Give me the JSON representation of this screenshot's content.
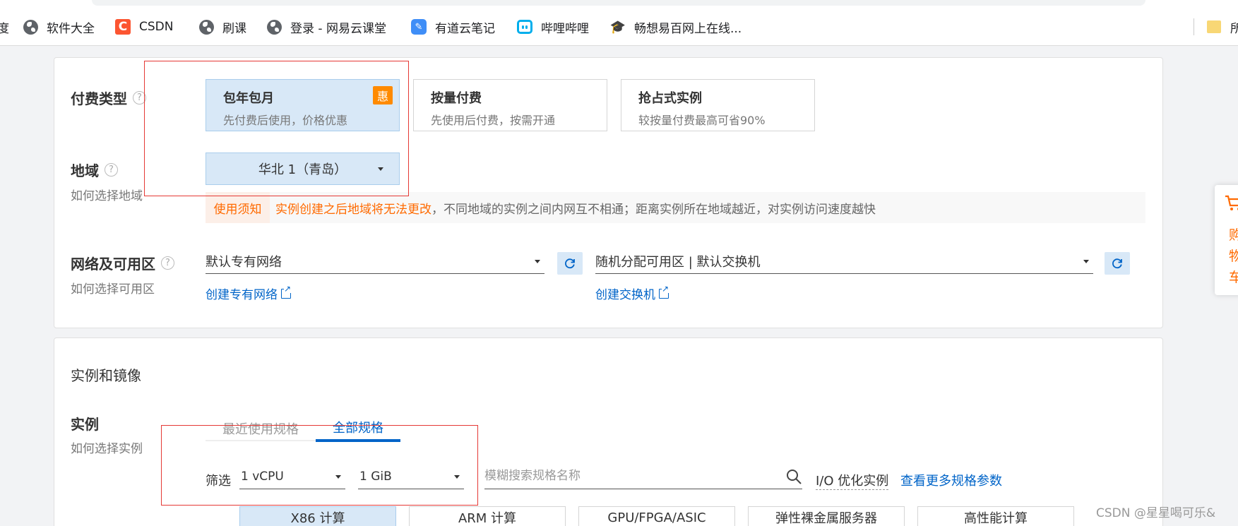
{
  "bookmarks": {
    "items": [
      {
        "label": "度",
        "icon": "none"
      },
      {
        "label": "软件大全",
        "icon": "globe-icon"
      },
      {
        "label": "CSDN",
        "icon": "csdn-icon"
      },
      {
        "label": "刷课",
        "icon": "globe-icon"
      },
      {
        "label": "登录 - 网易云课堂",
        "icon": "globe-icon"
      },
      {
        "label": "有道云笔记",
        "icon": "youdao-icon"
      },
      {
        "label": "哔哩哔哩",
        "icon": "bilibili-icon"
      },
      {
        "label": "畅想易百网上在线...",
        "icon": "graduation-cap-icon"
      },
      {
        "label": "所",
        "icon": "folder-icon"
      }
    ],
    "csdn_glyph": "C"
  },
  "payment": {
    "title": "付费类型",
    "help": "?",
    "options": [
      {
        "title": "包年包月",
        "desc": "先付费后使用，价格优惠",
        "badge": "惠",
        "selected": true
      },
      {
        "title": "按量付费",
        "desc": "先使用后付费，按需开通",
        "selected": false
      },
      {
        "title": "抢占式实例",
        "desc": "较按量付费最高可省90%",
        "selected": false
      }
    ]
  },
  "region": {
    "title": "地域",
    "help": "?",
    "how_link": "如何选择地域",
    "selected": "华北 1（青岛）",
    "notice_tag": "使用须知",
    "notice_warning": "实例创建之后地域将无法更改",
    "notice_rest": "，不同地域的实例之间内网互不相通；距离实例所在地域越近，对实例访问速度越快"
  },
  "network": {
    "title": "网络及可用区",
    "help": "?",
    "how_link": "如何选择可用区",
    "vpc_value": "默认专有网络",
    "zone_value": "随机分配可用区 | 默认交换机",
    "create_vpc": "创建专有网络",
    "create_switch": "创建交换机"
  },
  "instance_section": {
    "title": "实例和镜像",
    "instance_title": "实例",
    "how_link": "如何选择实例",
    "tabs": [
      {
        "label": "最近使用规格",
        "active": false
      },
      {
        "label": "全部规格",
        "active": true
      }
    ],
    "filter_label": "筛选",
    "vcpu_value": "1 vCPU",
    "mem_value": "1 GiB",
    "search_placeholder": "模糊搜索规格名称",
    "io_label": "I/O 优化实例",
    "more_params": "查看更多规格参数",
    "arch_tabs": [
      {
        "label": "X86 计算",
        "selected": true
      },
      {
        "label": "ARM 计算",
        "selected": false
      },
      {
        "label": "GPU/FPGA/ASIC",
        "selected": false
      },
      {
        "label": "弹性裸金属服务器",
        "selected": false
      },
      {
        "label": "高性能计算",
        "selected": false
      }
    ]
  },
  "cart": {
    "chars": [
      "购",
      "物",
      "车"
    ]
  },
  "watermark": "CSDN @星星喝可乐&",
  "colors": {
    "accent": "#0064c8",
    "warning": "#ff6a00",
    "selected_bg": "#d8e8f7",
    "annotation_red": "#e53935"
  }
}
